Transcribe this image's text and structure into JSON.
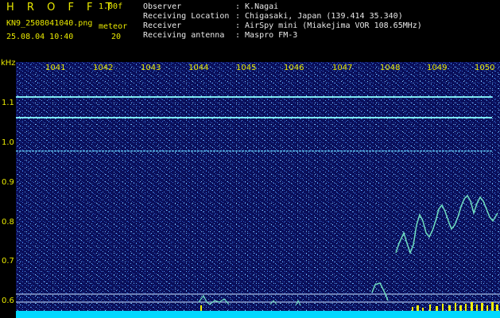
{
  "header": {
    "title": "H R O F F T",
    "version": "1.00f",
    "filename": "KN9_2508041040.png",
    "datetime": "25.08.04 10:40",
    "meteor_label": "meteor",
    "meteor_count": "20",
    "fields": [
      {
        "label": "Observer",
        "value": ": K.Nagai"
      },
      {
        "label": "Receiving Location",
        "value": ": Chigasaki, Japan (139.414 35.340)"
      },
      {
        "label": "Receiver",
        "value": ": AirSpy mini (Miakejima VOR 108.65MHz)"
      },
      {
        "label": "Receiving antenna",
        "value": ": Maspro FM-3"
      }
    ]
  },
  "y_axis": {
    "unit": "kHz",
    "ticks": [
      "1.1",
      "1.0",
      "0.9",
      "0.8",
      "0.7",
      "0.6"
    ]
  },
  "x_axis": {
    "ticks": [
      "1041",
      "1042",
      "1043",
      "1044",
      "1045",
      "1046",
      "1047",
      "1048",
      "1049",
      "1050"
    ]
  },
  "colors": {
    "background": "#0a0f5a",
    "noise": "#4aa8e8",
    "line": "#7ee8f0",
    "bottom_bar": "#00d8ff",
    "yellow_bars": "#f0f000",
    "text_yellow": "#e8e800"
  }
}
